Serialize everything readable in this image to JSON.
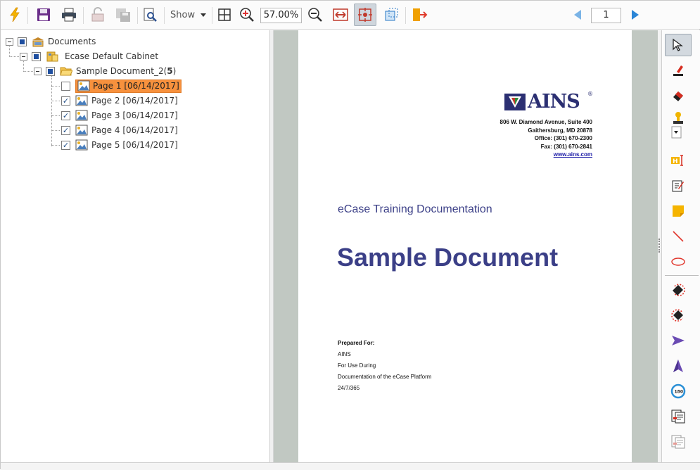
{
  "toolbar": {
    "show_label": "Show",
    "zoom_value": "57.00%",
    "page_number": "1"
  },
  "tree": {
    "root": {
      "label": "Documents"
    },
    "cabinet": {
      "label": "Ecase Default Cabinet"
    },
    "document": {
      "label_main": "Sample Document_2(",
      "label_count": "5",
      "label_close": ")"
    },
    "pages": [
      {
        "label": "Page 1 [06/14/2017]",
        "checked": false,
        "selected": true
      },
      {
        "label": "Page 2 [06/14/2017]",
        "checked": true,
        "selected": false
      },
      {
        "label": "Page 3 [06/14/2017]",
        "checked": true,
        "selected": false
      },
      {
        "label": "Page 4 [06/14/2017]",
        "checked": true,
        "selected": false
      },
      {
        "label": "Page 5 [06/14/2017]",
        "checked": true,
        "selected": false
      }
    ]
  },
  "document_page": {
    "logo_text": "AINS",
    "logo_mark": "®",
    "address": [
      "806 W. Diamond Avenue, Suite 400",
      "Gaithersburg, MD 20878",
      "Office: (301) 670-2300",
      "Fax: (301) 670-2841"
    ],
    "website": "www.ains.com",
    "subtitle": "eCase Training Documentation",
    "title": "Sample Document",
    "prepared_heading": "Prepared For:",
    "prepared_lines": [
      "AINS",
      "For Use During",
      "Documentation of the eCase Platform",
      "24/7/365"
    ]
  },
  "colors": {
    "accent_selection": "#f7913d",
    "document_title": "#3b3f87",
    "viewer_background": "#c1c8c2"
  }
}
